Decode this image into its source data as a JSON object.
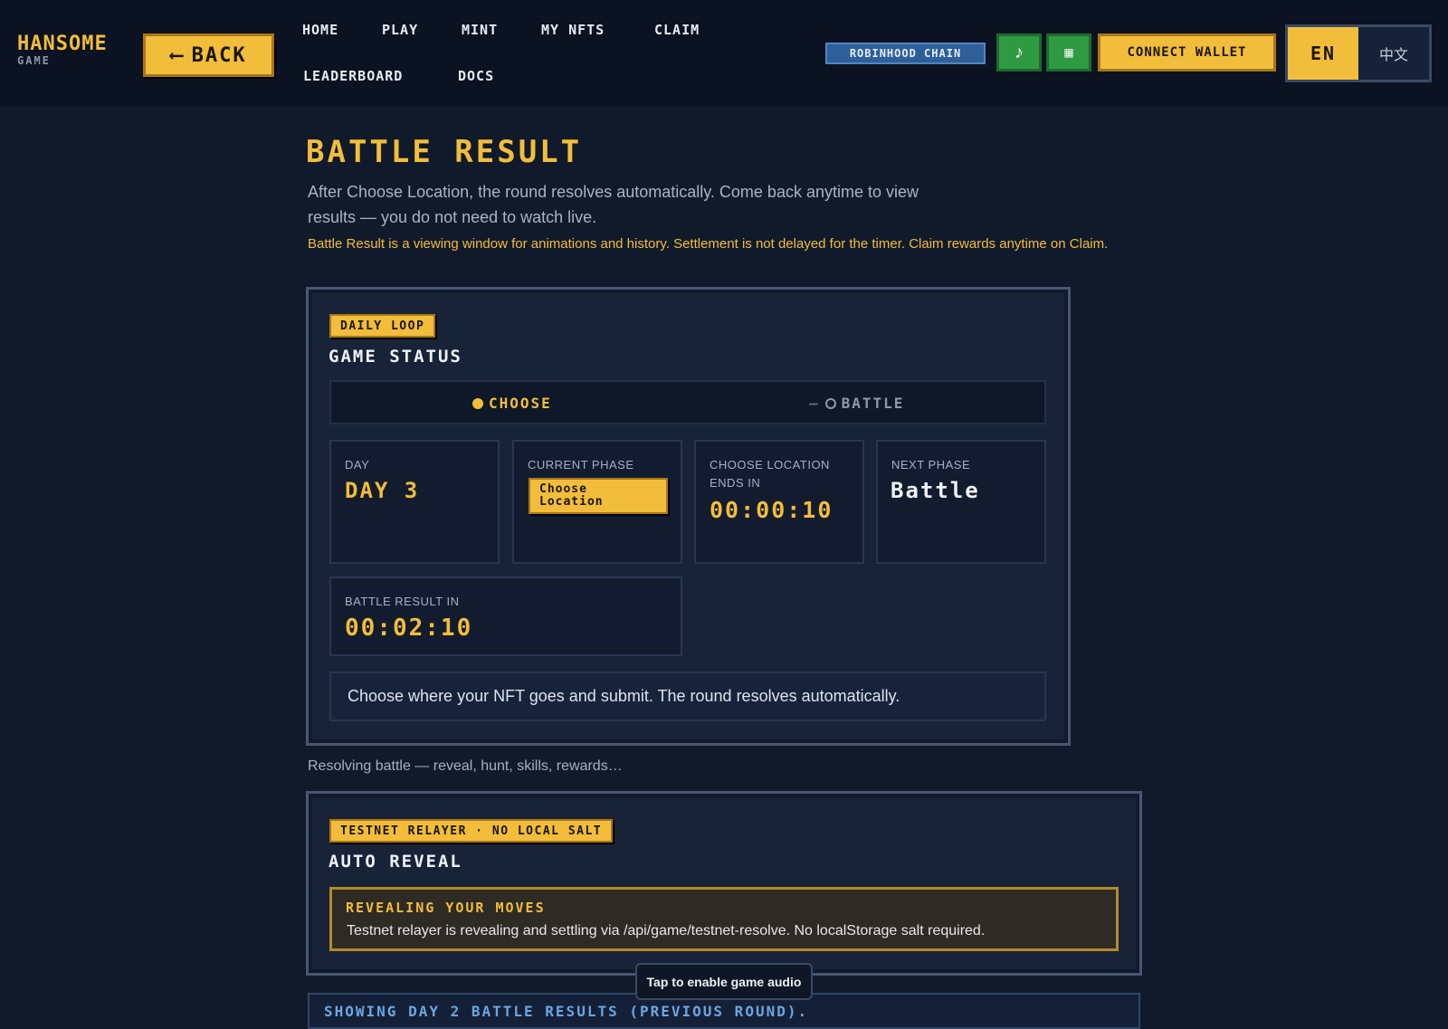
{
  "header": {
    "logo_main": "HANSOME",
    "logo_sub": "GAME",
    "back_arrow": "⟵",
    "back_label": "BACK",
    "nav": {
      "home": "HOME",
      "play": "PLAY",
      "mint": "MINT",
      "my_nfts": "MY NFTS",
      "claim": "CLAIM",
      "leaderboard": "LEADERBOARD",
      "docs": "DOCS"
    },
    "chain_label": "ROBINHOOD CHAIN",
    "music_icon": "♪",
    "grid_icon": "▦",
    "connect_wallet": "CONNECT WALLET",
    "lang_en": "EN",
    "lang_zh": "中文"
  },
  "page": {
    "title": "BATTLE RESULT",
    "intro": "After Choose Location, the round resolves automatically. Come back anytime to view results — you do not need to watch live.",
    "warning": "Battle Result is a viewing window for animations and history. Settlement is not delayed for the timer. Claim rewards anytime on Claim."
  },
  "game_status": {
    "tag": "DAILY LOOP",
    "title": "GAME STATUS",
    "phase_choose": "CHOOSE",
    "phase_dash": "—",
    "phase_battle": "BATTLE",
    "day_label": "DAY",
    "day_value": "DAY 3",
    "current_phase_label": "CURRENT PHASE",
    "current_phase_value": "Choose Location",
    "choose_ends_label": "CHOOSE LOCATION ENDS IN",
    "choose_ends_value": "00:00:10",
    "next_phase_label": "NEXT PHASE",
    "next_phase_value": "Battle",
    "battle_result_label": "BATTLE RESULT IN",
    "battle_result_value": "00:02:10",
    "info": "Choose where your NFT goes and submit. The round resolves automatically."
  },
  "resolving_text": "Resolving battle — reveal, hunt, skills, rewards…",
  "auto_reveal": {
    "tag": "TESTNET RELAYER · NO LOCAL SALT",
    "title": "AUTO REVEAL",
    "box_title": "REVEALING YOUR MOVES",
    "box_text": "Testnet relayer is revealing and settling via /api/game/testnet-resolve. No localStorage salt required."
  },
  "toast": "Tap to enable game audio",
  "showing_text": "SHOWING DAY 2 BATTLE RESULTS (PREVIOUS ROUND)."
}
